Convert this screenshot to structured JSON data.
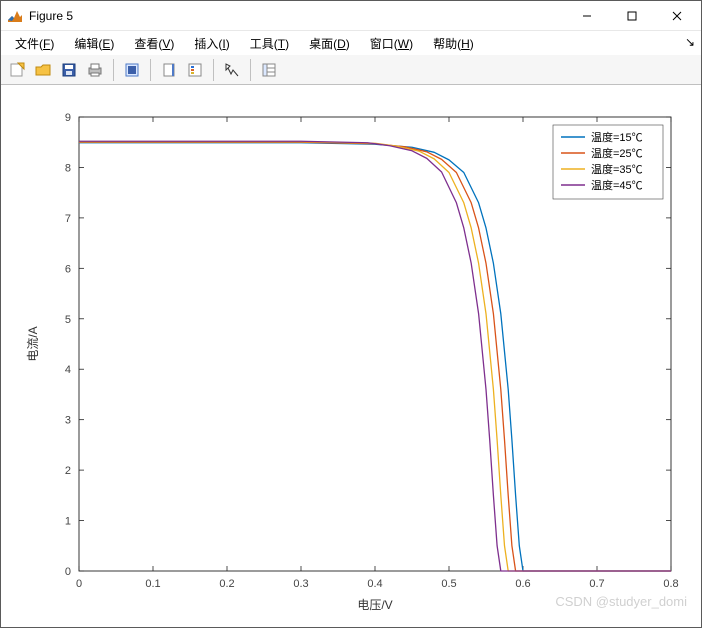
{
  "window": {
    "title": "Figure 5"
  },
  "menu": {
    "file": "文件(F)",
    "edit": "编辑(E)",
    "view": "查看(V)",
    "insert": "插入(I)",
    "tools": "工具(T)",
    "desktop": "桌面(D)",
    "window": "窗口(W)",
    "help": "帮助(H)"
  },
  "watermark": "CSDN @studyer_domi",
  "chart_data": {
    "type": "line",
    "title": "",
    "xlabel": "电压/V",
    "ylabel": "电流/A",
    "xlim": [
      0,
      0.8
    ],
    "ylim": [
      0,
      9
    ],
    "xticks": [
      0,
      0.1,
      0.2,
      0.3,
      0.4,
      0.5,
      0.6,
      0.7,
      0.8
    ],
    "yticks": [
      0,
      1,
      2,
      3,
      4,
      5,
      6,
      7,
      8,
      9
    ],
    "legend_position": "northeast",
    "series": [
      {
        "name": "温度=15℃",
        "color": "#0072BD",
        "x": [
          0,
          0.1,
          0.2,
          0.3,
          0.4,
          0.45,
          0.48,
          0.5,
          0.52,
          0.54,
          0.55,
          0.56,
          0.57,
          0.58,
          0.585,
          0.59,
          0.595,
          0.6,
          0.65,
          0.7,
          0.8
        ],
        "y": [
          8.49,
          8.49,
          8.49,
          8.49,
          8.46,
          8.4,
          8.3,
          8.15,
          7.9,
          7.3,
          6.8,
          6.1,
          5.1,
          3.6,
          2.6,
          1.5,
          0.5,
          0.0,
          0.0,
          0.0,
          0.0
        ]
      },
      {
        "name": "温度=25℃",
        "color": "#D95319",
        "x": [
          0,
          0.1,
          0.2,
          0.3,
          0.4,
          0.44,
          0.47,
          0.49,
          0.51,
          0.53,
          0.54,
          0.55,
          0.56,
          0.57,
          0.575,
          0.58,
          0.585,
          0.59,
          0.65,
          0.7,
          0.8
        ],
        "y": [
          8.5,
          8.5,
          8.5,
          8.5,
          8.47,
          8.41,
          8.31,
          8.16,
          7.9,
          7.3,
          6.8,
          6.1,
          5.1,
          3.6,
          2.6,
          1.5,
          0.5,
          0.0,
          0.0,
          0.0,
          0.0
        ]
      },
      {
        "name": "温度=35℃",
        "color": "#EDB120",
        "x": [
          0,
          0.1,
          0.2,
          0.3,
          0.4,
          0.43,
          0.46,
          0.48,
          0.5,
          0.52,
          0.53,
          0.54,
          0.55,
          0.56,
          0.565,
          0.57,
          0.575,
          0.58,
          0.65,
          0.7,
          0.8
        ],
        "y": [
          8.51,
          8.51,
          8.51,
          8.51,
          8.48,
          8.42,
          8.32,
          8.17,
          7.9,
          7.3,
          6.8,
          6.1,
          5.1,
          3.6,
          2.6,
          1.5,
          0.5,
          0.0,
          0.0,
          0.0,
          0.0
        ]
      },
      {
        "name": "温度=45℃",
        "color": "#7E2F8E",
        "x": [
          0,
          0.1,
          0.2,
          0.3,
          0.39,
          0.42,
          0.45,
          0.47,
          0.49,
          0.51,
          0.52,
          0.53,
          0.54,
          0.55,
          0.555,
          0.56,
          0.565,
          0.57,
          0.65,
          0.7,
          0.8
        ],
        "y": [
          8.52,
          8.52,
          8.52,
          8.52,
          8.49,
          8.43,
          8.33,
          8.18,
          7.91,
          7.3,
          6.8,
          6.1,
          5.1,
          3.6,
          2.6,
          1.5,
          0.5,
          0.0,
          0.0,
          0.0,
          0.0
        ]
      }
    ]
  }
}
